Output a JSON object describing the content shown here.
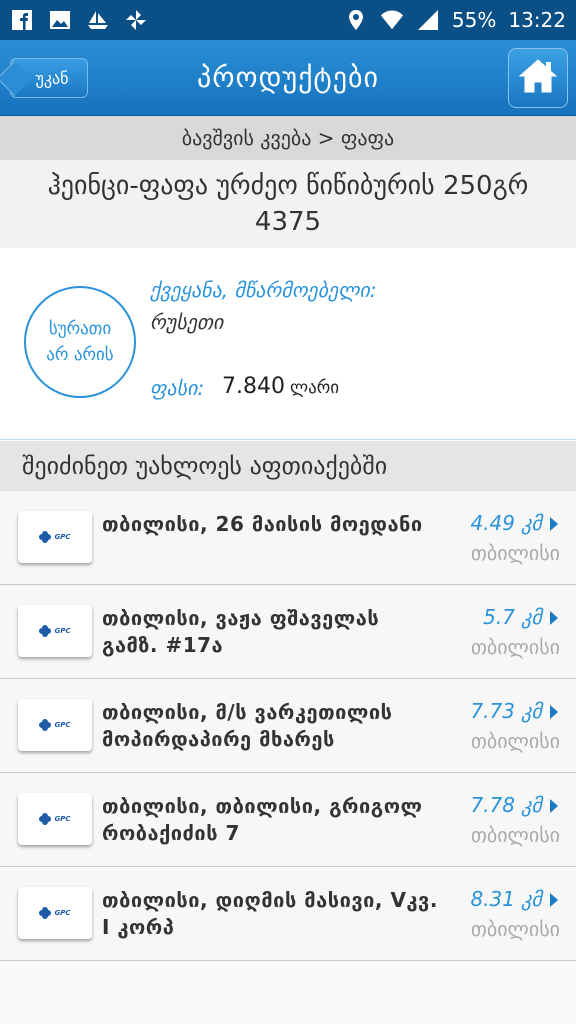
{
  "status_bar": {
    "battery": "55%",
    "time": "13:22",
    "left_icons": [
      "facebook-icon",
      "gallery-icon",
      "boat-icon",
      "pinwheel-icon"
    ],
    "right_icons": [
      "location-icon",
      "wifi-icon",
      "signal-icon"
    ]
  },
  "app_bar": {
    "back_label": "უკან",
    "title": "პროდუქტები",
    "home_icon": "home-icon"
  },
  "breadcrumb": "ბავშვის კვება > ფაფა",
  "product": {
    "title": "ჰეინცი-ფაფა ურძეო წიწიბურის 250გრ 4375",
    "no_image_line1": "სურათი",
    "no_image_line2": "არ არის",
    "country_label": "ქვეყანა, მწარმოებელი:",
    "country_value": "რუსეთი",
    "price_label": "ფასი:",
    "price_value": "7.840",
    "price_unit": "ლარი"
  },
  "section_header": "შეიძინეთ უახლოეს აფთიაქებში",
  "pharmacies": [
    {
      "address": "თბილისი, 26 მაისის მოედანი",
      "distance": "4.49 კმ",
      "city": "თბილისი"
    },
    {
      "address": "თბილისი, ვაჟა ფშაველას გამზ. #17ა",
      "distance": "5.7 კმ",
      "city": "თბილისი"
    },
    {
      "address": "თბილისი, მ/ს ვარკეთილის მოპირდაპირე მხარეს",
      "distance": "7.73 კმ",
      "city": "თბილისი"
    },
    {
      "address": "თბილისი, თბილისი, გრიგოლ რობაქიძის 7",
      "distance": "7.78 კმ",
      "city": "თბილისი"
    },
    {
      "address": "თბილისი, დიღმის მასივი, Vკვ.    I კორპ",
      "distance": "8.31 კმ",
      "city": "თბილისი"
    }
  ],
  "logo_text": "GPC",
  "colors": {
    "accent": "#2a93d9",
    "app_bar": "#1673bd",
    "status_bar": "#0a4f86"
  }
}
